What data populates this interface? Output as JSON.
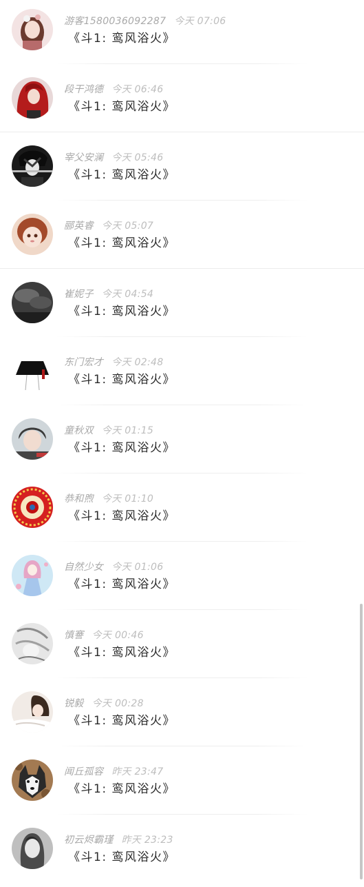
{
  "messages": [
    {
      "name": "游客1580036092287",
      "time": "今天 07:06",
      "text": "《斗1: 鸾风浴火》",
      "avatar_icon": "avatar-girl-icon",
      "avatar_colors": [
        "#f3e3e3",
        "#8a4c4c"
      ]
    },
    {
      "name": "段干鸿德",
      "time": "今天 06:46",
      "text": "《斗1: 鸾风浴火》",
      "avatar_icon": "avatar-red-hair-icon",
      "avatar_colors": [
        "#e8d8d8",
        "#b41c1c"
      ]
    },
    {
      "name": "宰父安澜",
      "time": "今天 05:46",
      "text": "《斗1: 鸾风浴火》",
      "avatar_icon": "avatar-dark-anime-icon",
      "avatar_colors": [
        "#d9d9d9",
        "#1a1a1a"
      ]
    },
    {
      "name": "郦英睿",
      "time": "今天 05:07",
      "text": "《斗1: 鸾风浴火》",
      "avatar_icon": "avatar-doll-icon",
      "avatar_colors": [
        "#f0d8c8",
        "#a34a2a"
      ]
    },
    {
      "name": "崔妮子",
      "time": "今天 04:54",
      "text": "《斗1: 鸾风浴火》",
      "avatar_icon": "avatar-dark-sky-icon",
      "avatar_colors": [
        "#6a6a6a",
        "#1e1e1e"
      ]
    },
    {
      "name": "东门宏才",
      "time": "今天 02:48",
      "text": "《斗1: 鸾风浴火》",
      "avatar_icon": "avatar-skirt-icon",
      "avatar_colors": [
        "#ffffff",
        "#111111"
      ]
    },
    {
      "name": "童秋双",
      "time": "今天 01:15",
      "text": "《斗1: 鸾风浴火》",
      "avatar_icon": "avatar-boy-icon",
      "avatar_colors": [
        "#cfd6da",
        "#3a3a3a"
      ]
    },
    {
      "name": "恭和煦",
      "time": "今天 01:10",
      "text": "《斗1: 鸾风浴火》",
      "avatar_icon": "avatar-red-emblem-icon",
      "avatar_colors": [
        "#f4cc4c",
        "#d52020"
      ]
    },
    {
      "name": "自然少女",
      "time": "今天 01:06",
      "text": "《斗1: 鸾风浴火》",
      "avatar_icon": "avatar-anime-girl-icon",
      "avatar_colors": [
        "#cfe8f5",
        "#e6a6c6"
      ]
    },
    {
      "name": "慎謇",
      "time": "今天 00:46",
      "text": "《斗1: 鸾风浴火》",
      "avatar_icon": "avatar-gray-sketch-icon",
      "avatar_colors": [
        "#e6e6e6",
        "#8c8c8c"
      ]
    },
    {
      "name": "锐毅",
      "time": "今天 00:28",
      "text": "《斗1: 鸾风浴火》",
      "avatar_icon": "avatar-sleeping-girl-icon",
      "avatar_colors": [
        "#f1ebe6",
        "#3b2a20"
      ]
    },
    {
      "name": "闻丘孤容",
      "time": "昨天 23:47",
      "text": "《斗1: 鸾风浴火》",
      "avatar_icon": "avatar-husky-icon",
      "avatar_colors": [
        "#a37a52",
        "#2a2a2a"
      ]
    },
    {
      "name": "初云烬霸瑾",
      "time": "昨天 23:23",
      "text": "《斗1: 鸾风浴火》",
      "avatar_icon": "avatar-pale-girl-icon",
      "avatar_colors": [
        "#d9d9d9",
        "#4a4a4a"
      ]
    }
  ],
  "scroll_position": 0.68
}
